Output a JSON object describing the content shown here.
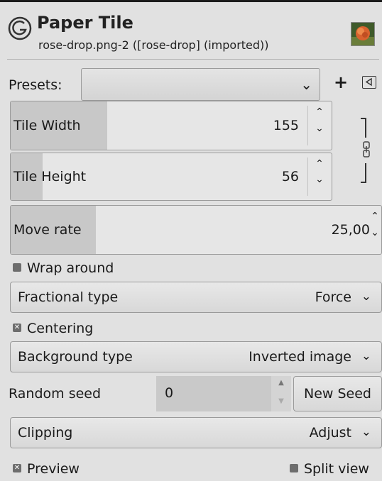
{
  "header": {
    "title": "Paper Tile",
    "subtitle": "rose-drop.png-2 ([rose-drop] (imported))",
    "logo_icon": "gimp-gegl-icon",
    "thumbnail": "rose-thumbnail"
  },
  "presets": {
    "label": "Presets:",
    "value": "",
    "add_label": "+",
    "menu_icon": "menu-triangle-icon"
  },
  "tile_width": {
    "label": "Tile Width",
    "value": "155",
    "fill_fraction": 0.3
  },
  "tile_height": {
    "label": "Tile Height",
    "value": "56",
    "fill_fraction": 0.1
  },
  "move_rate": {
    "label": "Move rate",
    "value": "25,00",
    "fill_fraction": 0.23
  },
  "wrap_around": {
    "label": "Wrap around",
    "checked": false
  },
  "fractional_type": {
    "label": "Fractional type",
    "value": "Force"
  },
  "centering": {
    "label": "Centering",
    "checked": true
  },
  "background_type": {
    "label": "Background type",
    "value": "Inverted image"
  },
  "random_seed": {
    "label": "Random seed",
    "value": "0",
    "button_label": "New Seed"
  },
  "clipping": {
    "label": "Clipping",
    "value": "Adjust"
  },
  "preview": {
    "label": "Preview",
    "checked": true
  },
  "split_view": {
    "label": "Split view",
    "checked": false
  },
  "colors": {
    "fill": "#c8c8c8",
    "background": "#e1e1e1",
    "checkbox": "#6d6d6d"
  }
}
